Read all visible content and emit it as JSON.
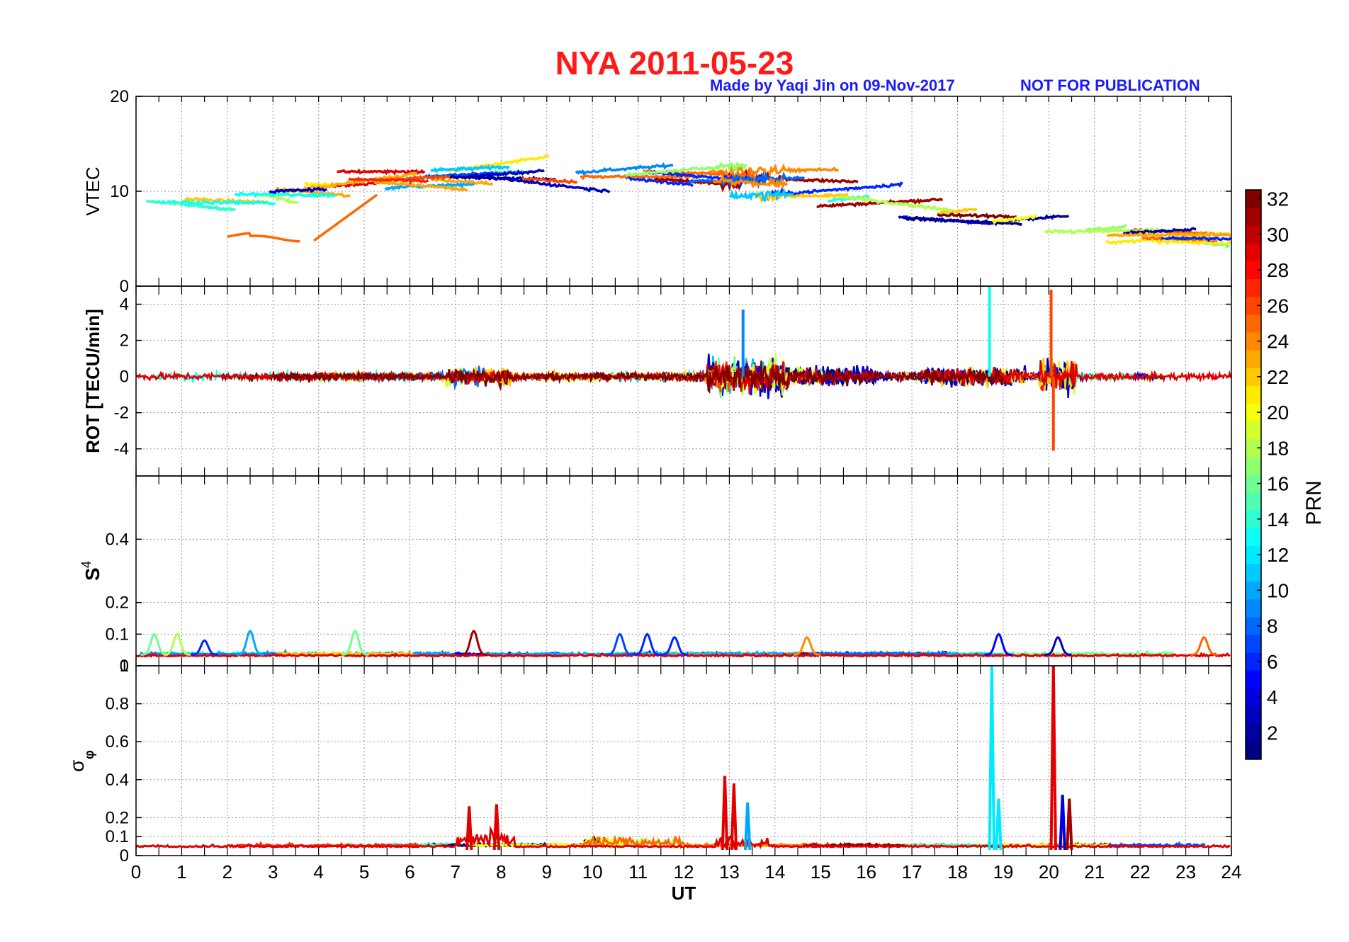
{
  "title": "NYA   2011-05-23",
  "credit": "Made by Yaqi Jin on 09-Nov-2017",
  "notice": "NOT FOR PUBLICATION",
  "colors": {
    "title": "#ff1a1a",
    "credit": "#1a1aff"
  },
  "chart_data": [
    {
      "type": "line",
      "panel": "VTEC",
      "ylabel": "VTEC",
      "ylim": [
        0,
        20
      ],
      "yticks": [
        "0",
        "10",
        "20"
      ],
      "xlim": [
        0,
        24
      ],
      "grid": true,
      "description_values": "multiple PRN arcs, VTEC mostly between 5 and 14 TECU",
      "series_summary": [
        {
          "x": [
            0.2,
            2,
            4,
            6,
            8,
            10,
            12,
            14,
            16,
            18,
            20,
            22,
            24
          ],
          "y": [
            9,
            9.5,
            10,
            12,
            12,
            12.5,
            11,
            9.5,
            8.5,
            9.5,
            10,
            9,
            7
          ]
        }
      ]
    },
    {
      "type": "line",
      "panel": "ROT",
      "ylabel": "ROT [TECU/min]",
      "ylim": [
        -5.5,
        5
      ],
      "yticks": [
        "-4",
        "-2",
        "0",
        "2",
        "4"
      ],
      "xlim": [
        0,
        24
      ],
      "grid": true,
      "peaks": [
        {
          "x": 18.7,
          "y": 5.0
        },
        {
          "x": 20.05,
          "y": 4.8
        },
        {
          "x": 20.1,
          "y": -4.1
        },
        {
          "x": 13.3,
          "y": 3.7
        }
      ]
    },
    {
      "type": "line",
      "panel": "S4",
      "ylabel": "S4",
      "ylim": [
        0,
        0.6
      ],
      "yticks": [
        "0",
        "0.1",
        "0.2",
        "0.4"
      ],
      "xlim": [
        0,
        24
      ],
      "grid": true,
      "peaks": [
        {
          "x": 7.4,
          "y": 0.11
        },
        {
          "x": 2.5,
          "y": 0.11
        },
        {
          "x": 18.9,
          "y": 0.1
        }
      ]
    },
    {
      "type": "line",
      "panel": "sigma_phi",
      "ylabel": "σφ",
      "ylim": [
        0,
        1
      ],
      "yticks": [
        "0",
        "0.1",
        "0.2",
        "0.4",
        "0.6",
        "0.8",
        "1"
      ],
      "xlim": [
        0,
        24
      ],
      "xlabel": "UT",
      "xticks": [
        "0",
        "1",
        "2",
        "3",
        "4",
        "5",
        "6",
        "7",
        "8",
        "9",
        "10",
        "11",
        "12",
        "13",
        "14",
        "15",
        "16",
        "17",
        "18",
        "19",
        "20",
        "21",
        "22",
        "23",
        "24"
      ],
      "grid": true,
      "peaks": [
        {
          "x": 18.75,
          "y": 1.0
        },
        {
          "x": 20.1,
          "y": 1.0
        },
        {
          "x": 12.9,
          "y": 0.42
        },
        {
          "x": 7.9,
          "y": 0.27
        }
      ]
    }
  ],
  "colorbar": {
    "label": "PRN",
    "range": [
      1,
      32
    ],
    "ticks": [
      "2",
      "4",
      "6",
      "8",
      "10",
      "12",
      "14",
      "16",
      "18",
      "20",
      "22",
      "24",
      "26",
      "28",
      "30",
      "32"
    ]
  }
}
